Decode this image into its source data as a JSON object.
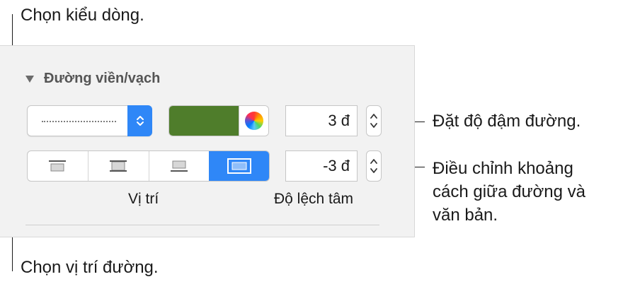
{
  "callouts": {
    "line_style": "Chọn kiểu dòng.",
    "line_weight": "Đặt độ đậm đường.",
    "offset_line1": "Điều chỉnh khoảng",
    "offset_line2": "cách giữa đường và",
    "offset_line3": "văn bản.",
    "position": "Chọn vị trí đường."
  },
  "section": {
    "title": "Đường viền/vạch",
    "collapsed": false
  },
  "line_style": {
    "selected": "dotted"
  },
  "color": {
    "fill": "#4f7d2b"
  },
  "weight": {
    "value": "3 đ"
  },
  "offset": {
    "value": "-3 đ",
    "label": "Độ lệch tâm"
  },
  "position": {
    "label": "Vị trí",
    "options": [
      "top-rule-icon",
      "middle-rule-icon",
      "bottom-rule-icon",
      "frame-rule-icon"
    ],
    "selected_index": 3
  },
  "colors": {
    "accent": "#2f87f7",
    "panel": "#f2f2f2"
  }
}
